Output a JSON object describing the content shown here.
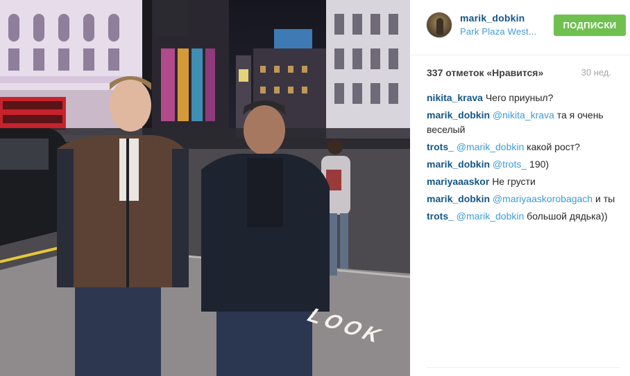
{
  "post": {
    "username": "marik_dobkin",
    "location": "Park Plaza West...",
    "follow_label": "ПОДПИСКИ",
    "likes_text": "337 отметок «Нравится»",
    "age": "30 нед.",
    "photo_text": {
      "street_marking": "LOOK"
    }
  },
  "comments": [
    {
      "author": "nikita_krava",
      "mention": "",
      "text": "Чего приуныл?"
    },
    {
      "author": "marik_dobkin",
      "mention": "@nikita_krava",
      "text": "та я очень веселый"
    },
    {
      "author": "trots_",
      "mention": "@marik_dobkin",
      "text": "какой рост?"
    },
    {
      "author": "marik_dobkin",
      "mention": "@trots_",
      "text": "190)"
    },
    {
      "author": "mariyaaaskor",
      "mention": "",
      "text": "Не грусти"
    },
    {
      "author": "marik_dobkin",
      "mention": "@mariyaaskorobagach",
      "text": "и ты"
    },
    {
      "author": "trots_",
      "mention": "@marik_dobkin",
      "text": "большой дядька))"
    }
  ],
  "colors": {
    "username": "#125688",
    "mention": "#3d9bd8",
    "follow_button": "#70c050",
    "muted": "#a5a7aa"
  }
}
